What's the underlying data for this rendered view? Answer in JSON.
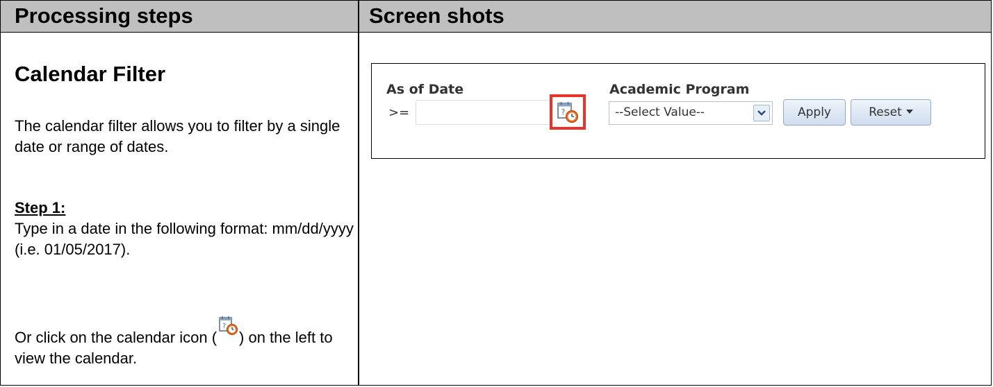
{
  "table": {
    "headers": [
      "Processing steps",
      "Screen shots"
    ]
  },
  "left": {
    "title": "Calendar Filter",
    "intro": "The calendar filter allows you to filter by a single date or range of dates.",
    "step_label": "Step 1:",
    "step_text": "Type in a date in the following format: mm/dd/yyyy (i.e. 01/05/2017).",
    "alt_before": "Or click on the calendar icon (",
    "alt_after": ") on the left to view the calendar."
  },
  "screenshot": {
    "date_label": "As of Date",
    "operator": ">=",
    "date_value": "",
    "program_label": "Academic Program",
    "select_value": "--Select Value--",
    "apply_label": "Apply",
    "reset_label": "Reset",
    "highlight_color": "#e8332a",
    "icons": [
      "calendar-clock-icon",
      "chevron-down-icon",
      "caret-down-icon"
    ]
  }
}
